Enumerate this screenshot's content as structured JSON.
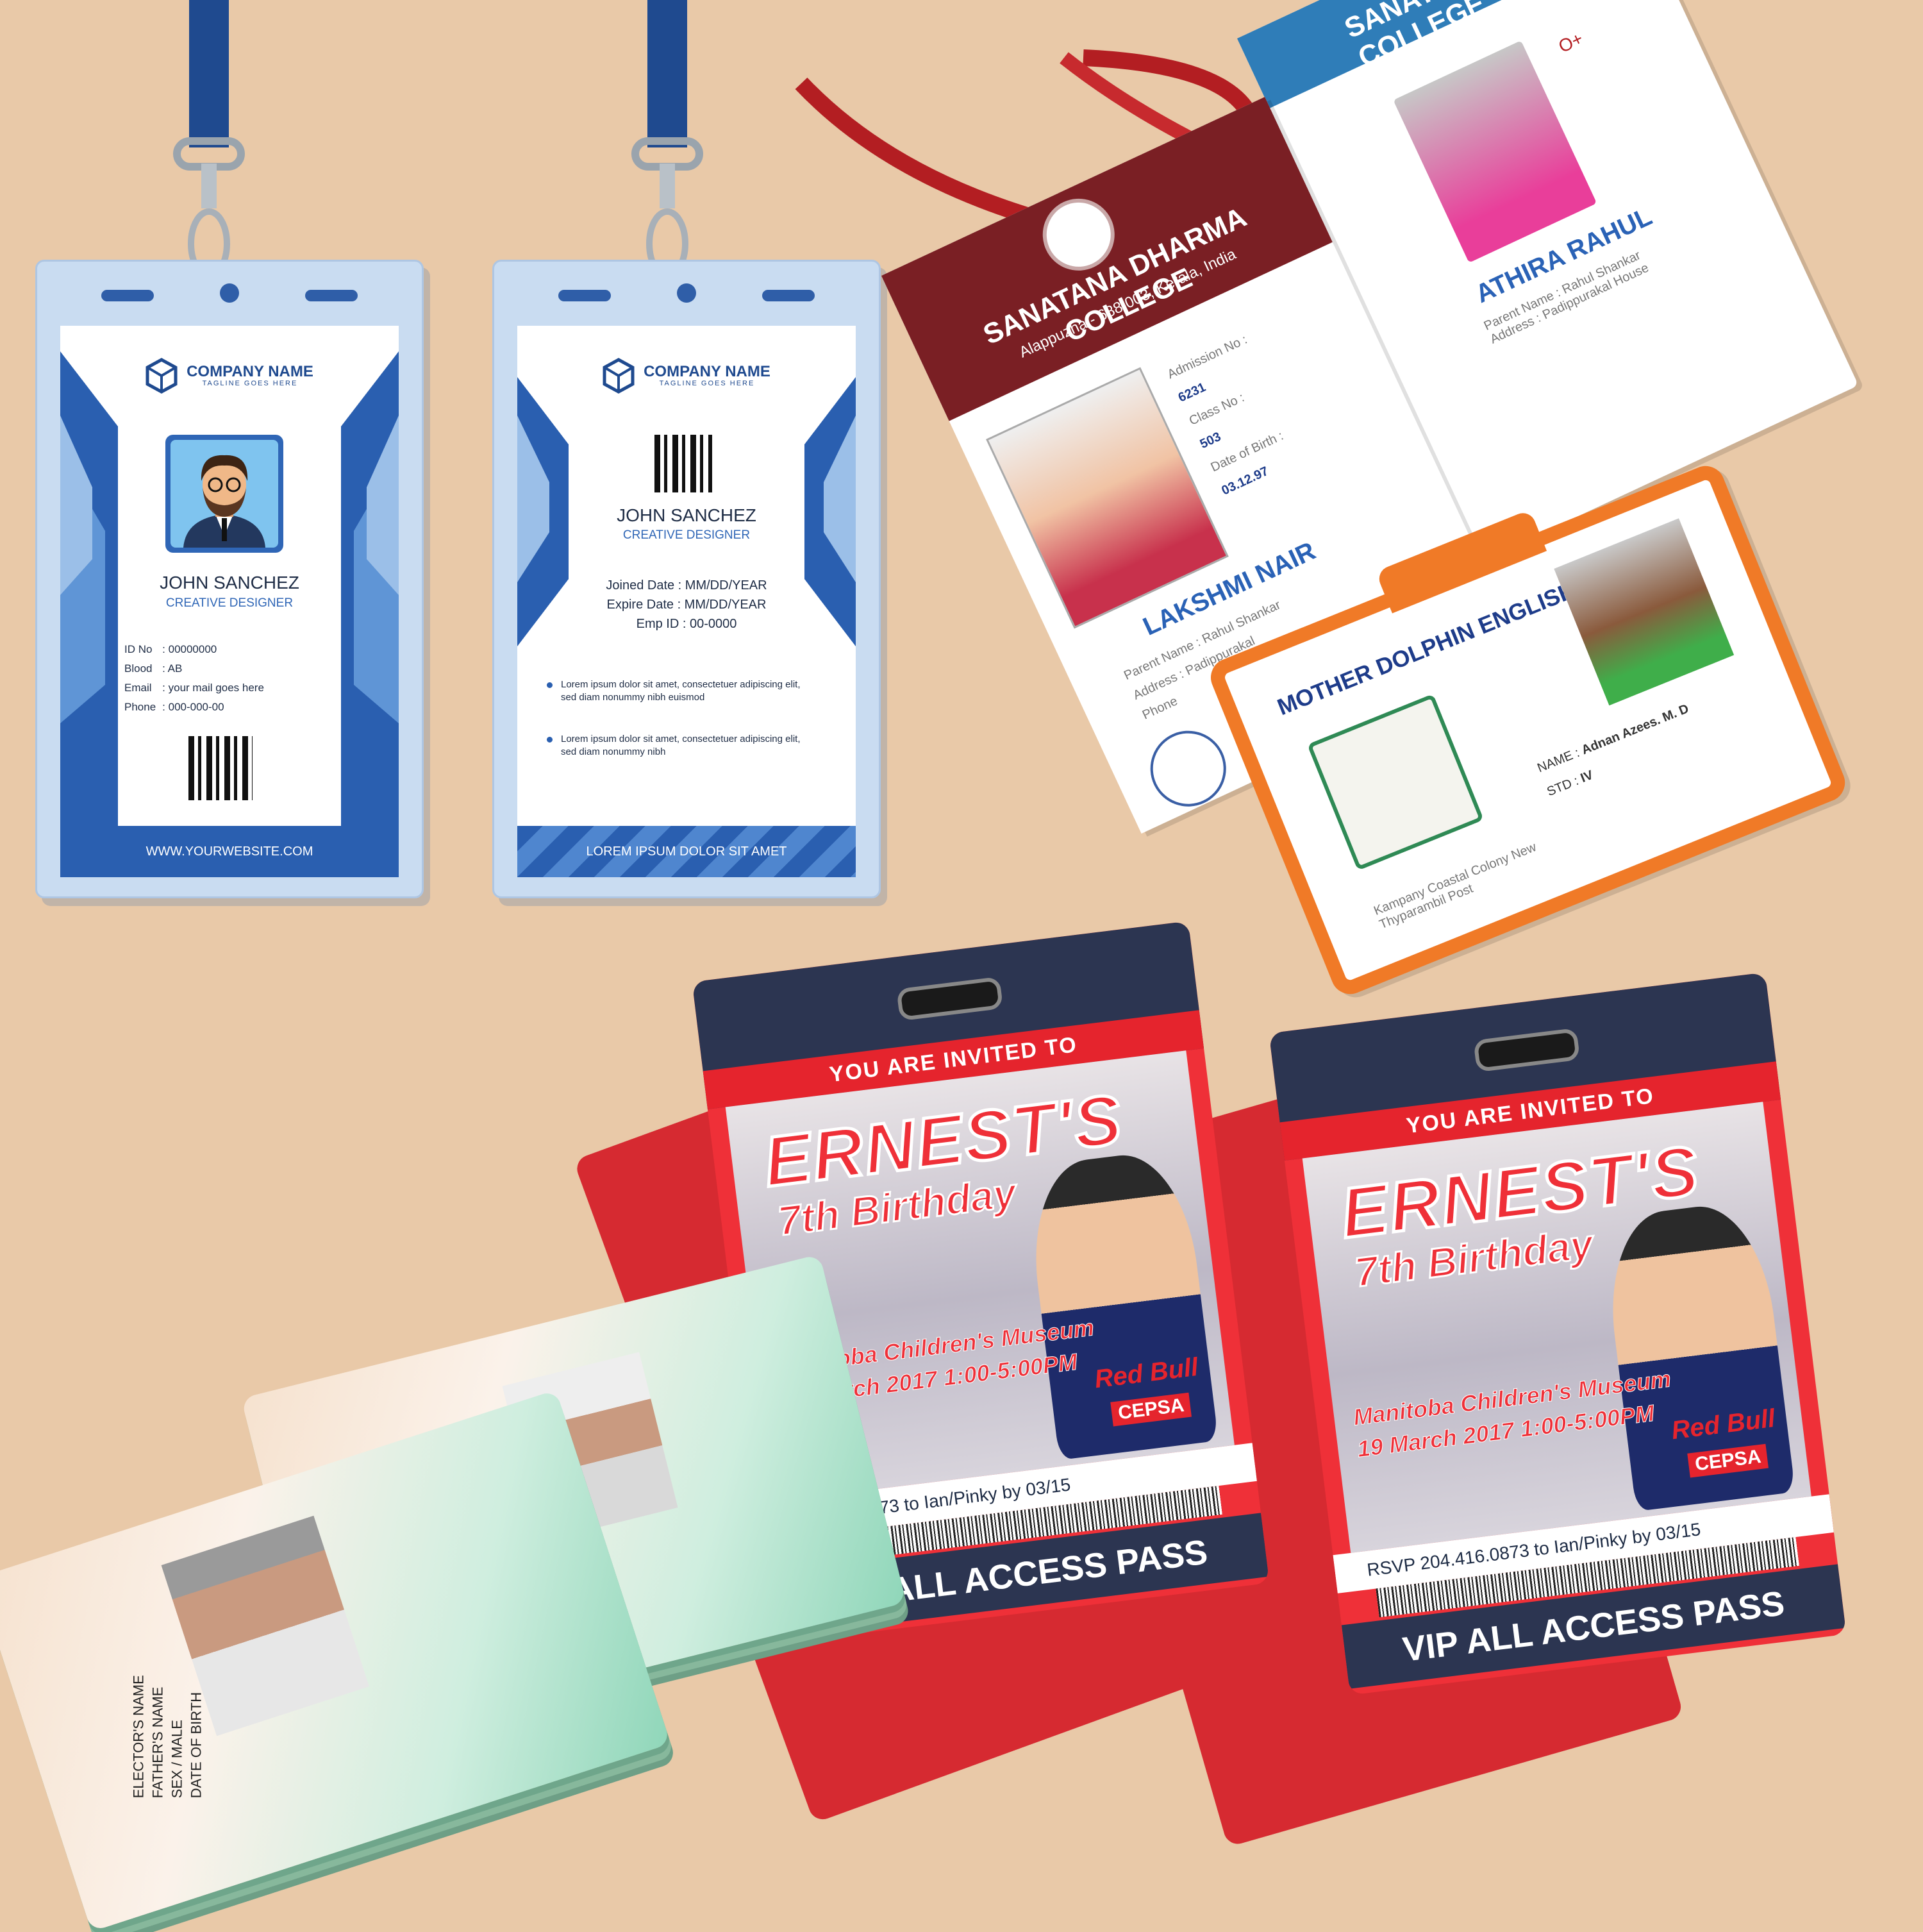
{
  "background_color": "#e9c9a8",
  "badge_front": {
    "company": "COMPANY NAME",
    "tagline": "TAGLINE GOES HERE",
    "name": "JOHN SANCHEZ",
    "role": "CREATIVE DESIGNER",
    "fields": [
      {
        "label": "ID No",
        "value": ": 00000000"
      },
      {
        "label": "Blood",
        "value": ": AB"
      },
      {
        "label": "Email",
        "value": ": your mail goes here"
      },
      {
        "label": "Phone",
        "value": ": 000-000-00"
      }
    ],
    "footer": "WWW.YOURWEBSITE.COM"
  },
  "badge_back": {
    "company": "COMPANY NAME",
    "tagline": "TAGLINE GOES HERE",
    "name": "JOHN SANCHEZ",
    "role": "CREATIVE DESIGNER",
    "joined": "Joined Date : MM/DD/YEAR",
    "expire": "Expire Date : MM/DD/YEAR",
    "emp": "Emp ID : 00-0000",
    "bullets": [
      "Lorem ipsum dolor sit amet, consectetuer adipiscing elit, sed diam nonummy nibh euismod",
      "Lorem ipsum dolor sit amet, consectetuer adipiscing elit, sed diam nonummy nibh"
    ],
    "footer": "LOREM IPSUM DOLOR SIT AMET"
  },
  "college_card": {
    "title": "SANATANA DHARMA COLLEGE",
    "address": "Alappuzha - 688 003, Kerala, India",
    "admission_label": "Admission No :",
    "admission_value": "6231",
    "class_label": "Class No :",
    "class_value": "503",
    "dob_label": "Date of Birth :",
    "dob_value": "03.12.97",
    "student": "LAKSHMI NAIR",
    "parent_label": "Parent Name :",
    "parent_value": "Rahul Shankar",
    "address_label": "Address :",
    "address_value": "Padippurakal",
    "phone_label": "Phone"
  },
  "college_card_back": {
    "title": "SANATANA DHARMA COLLEGE",
    "student": "ATHIRA RAHUL",
    "parent_label": "Parent Name :",
    "parent_value": "Rahul Shankar",
    "address_label": "Address :",
    "address_value": "Padippurakal House",
    "blood": "O+"
  },
  "school_card": {
    "title": "MOTHER DOLPHIN ENGLISH SCHOOL",
    "name_label": "NAME :",
    "name_value": "Adnan Azees. M. D",
    "std_label": "STD :",
    "std_value": "IV",
    "address": "Kampany Coastal Colony New Thyparambil Post"
  },
  "party_pass_1": {
    "invited": "YOU ARE INVITED TO",
    "title": "ERNEST'S",
    "subtitle": "7th Birthday",
    "venue": "Manitoba Children's Museum",
    "date": "19 March 2017  1:00-5:00PM",
    "rsvp": "204.416.0873 to Ian/Pinky by 03/15",
    "vip": "VIP ALL ACCESS PASS",
    "sponsor1": "Red Bull",
    "sponsor2": "CEPSA"
  },
  "party_pass_2": {
    "invited": "YOU ARE INVITED TO",
    "title": "ERNEST'S",
    "subtitle": "7th Birthday",
    "venue": "Manitoba Children's Museum",
    "date": "19 March 2017  1:00-5:00PM",
    "rsvp": "RSVP  204.416.0873 to Ian/Pinky by 03/15",
    "vip": "VIP ALL ACCESS PASS",
    "sponsor1": "Red Bull",
    "sponsor2": "CEPSA"
  },
  "voter_card": {
    "fields": [
      "ELECTOR'S NAME",
      "FATHER'S NAME",
      "SEX / MALE",
      "DATE OF BIRTH"
    ]
  }
}
